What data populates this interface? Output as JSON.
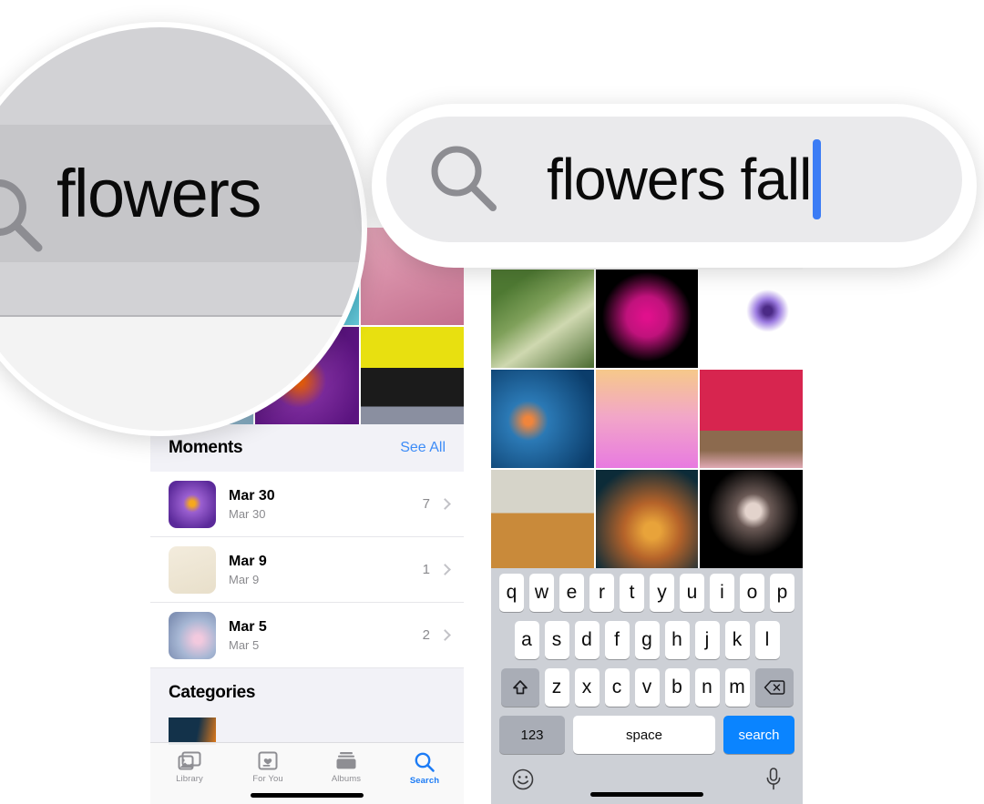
{
  "app": {
    "name": "Photos",
    "platform": "iOS"
  },
  "magnifier_left": {
    "label": "magnified-search-field-before",
    "search_icon": "search-icon",
    "query_text": "flowers",
    "field_bg": "#c6c6c9"
  },
  "magnifier_right": {
    "label": "magnified-search-field-after",
    "search_icon": "search-icon",
    "query_text": "flowers fall",
    "caret_color": "#3b7cf5",
    "field_bg": "#eaeaec"
  },
  "left_phone": {
    "photo_grid": [
      {
        "name": "blossom-blue-thumb",
        "colors": [
          "#8fc4d8",
          "#2f6f86"
        ]
      },
      {
        "name": "cherry-blossom-teal-thumb",
        "colors": [
          "#0f8ca6",
          "#67c8d9"
        ]
      },
      {
        "name": "pink-blossom-thumb",
        "colors": [
          "#e7a7bb",
          "#c36f8e"
        ]
      },
      {
        "name": "frost-branch-thumb",
        "colors": [
          "#2a9fd0",
          "#bcd9e8"
        ]
      },
      {
        "name": "purple-orange-bubbles-thumb",
        "colors": [
          "#5b1480",
          "#f1610d"
        ]
      },
      {
        "name": "black-puppy-daffodils-thumb",
        "colors": [
          "#e8e010",
          "#1b1b1b"
        ]
      }
    ],
    "moments": {
      "title": "Moments",
      "see_all": "See All",
      "rows": [
        {
          "thumb": "purple-crocus-thumb",
          "title": "Mar 30",
          "subtitle": "Mar 30",
          "count": "7",
          "chevron": "chevron-right-icon"
        },
        {
          "thumb": "violet-sprout-thumb",
          "title": "Mar 9",
          "subtitle": "Mar 9",
          "count": "1",
          "chevron": "chevron-right-icon"
        },
        {
          "thumb": "pink-bloom-thumb",
          "title": "Mar 5",
          "subtitle": "Mar 5",
          "count": "2",
          "chevron": "chevron-right-icon"
        }
      ]
    },
    "categories": {
      "title": "Categories"
    },
    "tabbar": {
      "items": [
        {
          "label": "Library",
          "icon": "photo-stack-icon",
          "active": false
        },
        {
          "label": "For You",
          "icon": "heart-card-icon",
          "active": false
        },
        {
          "label": "Albums",
          "icon": "albums-icon",
          "active": false
        },
        {
          "label": "Search",
          "icon": "search-icon",
          "active": true
        }
      ],
      "active_color": "#1d7cf5",
      "inactive_color": "#8e8e93"
    }
  },
  "right_phone": {
    "photo_grid": [
      {
        "name": "white-bell-flowers-thumb",
        "colors": [
          "#4f7a33",
          "#cfd8b0"
        ]
      },
      {
        "name": "magenta-dahlia-black-thumb",
        "colors": [
          "#000000",
          "#e0108c"
        ]
      },
      {
        "name": "purple-anemone-white-thumb",
        "colors": [
          "#ffffff",
          "#7e4fd0"
        ]
      },
      {
        "name": "leaf-on-blue-water-thumb",
        "colors": [
          "#0b3d6b",
          "#2b79b5"
        ]
      },
      {
        "name": "violet-iris-gradient-thumb",
        "colors": [
          "#f6c98a",
          "#e87ae0"
        ]
      },
      {
        "name": "red-maple-tree-thumb",
        "colors": [
          "#d7254f",
          "#8c6a4e"
        ]
      },
      {
        "name": "cornflowers-field-thumb",
        "colors": [
          "#d6d4c9",
          "#c98a3a"
        ]
      },
      {
        "name": "orange-tulips-dark-thumb",
        "colors": [
          "#0c2b38",
          "#e8a33a"
        ]
      },
      {
        "name": "white-daisy-black-thumb",
        "colors": [
          "#000000",
          "#e3d3cc"
        ]
      }
    ],
    "keyboard": {
      "row1": [
        "q",
        "w",
        "e",
        "r",
        "t",
        "y",
        "u",
        "i",
        "o",
        "p"
      ],
      "row2": [
        "a",
        "s",
        "d",
        "f",
        "g",
        "h",
        "j",
        "k",
        "l"
      ],
      "row3": [
        "z",
        "x",
        "c",
        "v",
        "b",
        "n",
        "m"
      ],
      "shift_icon": "shift-arrow-icon",
      "backspace_icon": "backspace-delete-icon",
      "numeric_label": "123",
      "space_label": "space",
      "search_label": "search",
      "search_key_color": "#0a84ff",
      "emoji_icon": "emoji-smiley-icon",
      "dictation_icon": "microphone-icon"
    }
  }
}
